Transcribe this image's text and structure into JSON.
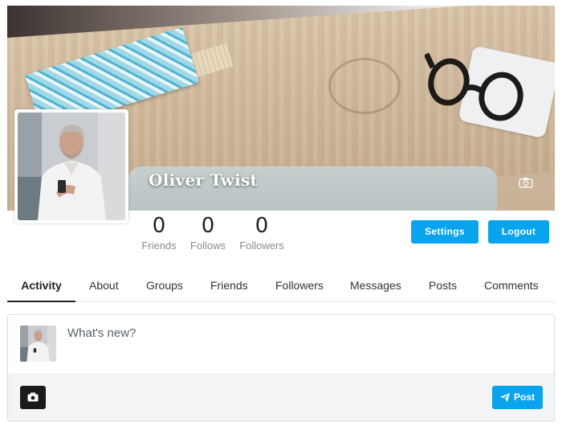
{
  "profile": {
    "name": "Oliver Twist",
    "cover_camera_icon": "camera-icon"
  },
  "stats": [
    {
      "value": "0",
      "label": "Friends"
    },
    {
      "value": "0",
      "label": "Follows"
    },
    {
      "value": "0",
      "label": "Followers"
    }
  ],
  "actions": {
    "settings_label": "Settings",
    "logout_label": "Logout"
  },
  "tabs": [
    {
      "label": "Activity",
      "active": true
    },
    {
      "label": "About"
    },
    {
      "label": "Groups"
    },
    {
      "label": "Friends"
    },
    {
      "label": "Followers"
    },
    {
      "label": "Messages"
    },
    {
      "label": "Posts"
    },
    {
      "label": "Comments"
    }
  ],
  "composer": {
    "placeholder": "What's new?",
    "post_label": "Post",
    "photo_icon": "camera-icon",
    "post_icon": "paper-plane-icon"
  },
  "colors": {
    "accent": "#0aa4ee",
    "dark_button": "#1a1a1a"
  }
}
